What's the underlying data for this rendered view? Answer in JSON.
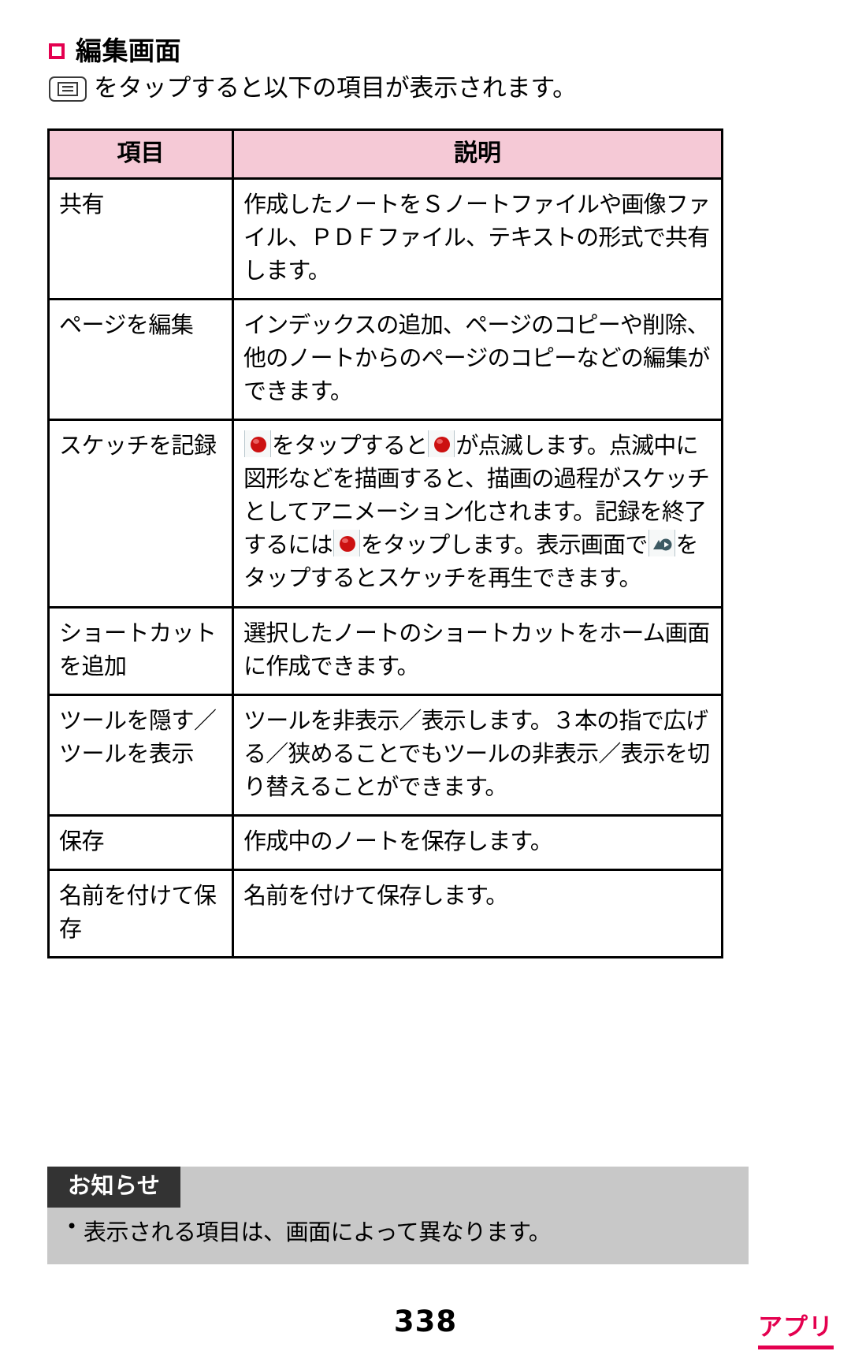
{
  "heading": {
    "bullet_color": "#e4004f",
    "title": "編集画面"
  },
  "intro": {
    "menu_key_icon": "menu-key-icon",
    "text": "をタップすると以下の項目が表示されます。"
  },
  "table": {
    "columns": [
      "項目",
      "説明"
    ],
    "header_bg": "#f5c9d6",
    "rows": [
      {
        "item": "共有",
        "desc": "作成したノートをＳノートファイルや画像ファイル、ＰＤＦファイル、テキストの形式で共有します。"
      },
      {
        "item": "ページを編集",
        "desc": "インデックスの追加、ページのコピーや削除、他のノートからのページのコピーなどの編集ができます。"
      },
      {
        "item": "スケッチを記録",
        "desc_parts": [
          {
            "type": "icon",
            "name": "record-red-dot-icon"
          },
          {
            "type": "text",
            "value": "をタップすると"
          },
          {
            "type": "icon",
            "name": "record-red-dot-icon"
          },
          {
            "type": "text",
            "value": "が点滅します。点滅中に図形などを描画すると、描画の過程がスケッチとしてアニメーション化されます。記録を終了するには"
          },
          {
            "type": "icon",
            "name": "record-red-dot-icon"
          },
          {
            "type": "text",
            "value": "をタップします。表示画面で"
          },
          {
            "type": "icon",
            "name": "sketch-play-icon"
          },
          {
            "type": "text",
            "value": "をタップするとスケッチを再生できます。"
          }
        ]
      },
      {
        "item": "ショートカットを追加",
        "desc": "選択したノートのショートカットをホーム画面に作成できます。"
      },
      {
        "item": "ツールを隠す／ツールを表示",
        "desc": "ツールを非表示／表示します。３本の指で広げる／狭めることでもツールの非表示／表示を切り替えることができます。"
      },
      {
        "item": "保存",
        "desc": "作成中のノートを保存します。"
      },
      {
        "item": "名前を付けて保存",
        "desc": "名前を付けて保存します。"
      }
    ]
  },
  "notice": {
    "tag": "お知らせ",
    "bullet": "•",
    "text": "表示される項目は、画面によって異なります。",
    "bg_color": "#c8c8c8",
    "tag_bg_color": "#333333"
  },
  "footer": {
    "page_number": "338",
    "section_label": "アプリ",
    "accent_color": "#e4004f"
  },
  "icons": {
    "record_red_dot_color": "#cc1111",
    "sketch_play_color": "#3d5a63"
  }
}
